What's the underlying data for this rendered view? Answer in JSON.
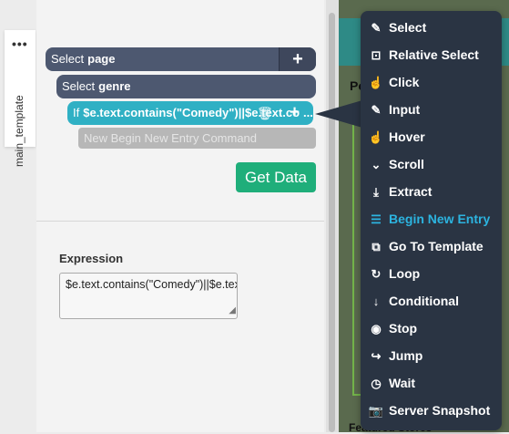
{
  "side_tab": {
    "dots": "•••",
    "label": "main_template"
  },
  "commands": [
    {
      "prefix": "Select",
      "target": "page"
    },
    {
      "prefix": "Select",
      "target": "genre"
    },
    {
      "prefix": "If",
      "target": "$e.text.contains(\"Comedy\")||$e.text.co"
    },
    {
      "prefix": "New Begin New Entry Command"
    }
  ],
  "toolbar": {
    "plus": "+",
    "ellipsis": "...",
    "trash": "🗑"
  },
  "get_data_label": "Get Data",
  "expression": {
    "title": "Expression",
    "value": "$e.text.contains(\"Comedy\")||$e.text.contains(\"Drama\")",
    "grip": "◢"
  },
  "background": {
    "text_po": "Po",
    "text_featured": "Featured Stores"
  },
  "menu": {
    "items": [
      {
        "label": "Select",
        "icon": "✎"
      },
      {
        "label": "Relative Select",
        "icon": "⊡"
      },
      {
        "label": "Click",
        "icon": "☝"
      },
      {
        "label": "Input",
        "icon": "✎"
      },
      {
        "label": "Hover",
        "icon": "☝"
      },
      {
        "label": "Scroll",
        "icon": "⌄"
      },
      {
        "label": "Extract",
        "icon": "⤓"
      },
      {
        "label": "Begin New Entry",
        "icon": "☰",
        "active": true
      },
      {
        "label": "Go To Template",
        "icon": "⧉"
      },
      {
        "label": "Loop",
        "icon": "↻"
      },
      {
        "label": "Conditional",
        "icon": "↓"
      },
      {
        "label": "Stop",
        "icon": "◉"
      },
      {
        "label": "Jump",
        "icon": "↪"
      },
      {
        "label": "Wait",
        "icon": "◷"
      },
      {
        "label": "Server Snapshot",
        "icon": "📷"
      }
    ]
  }
}
